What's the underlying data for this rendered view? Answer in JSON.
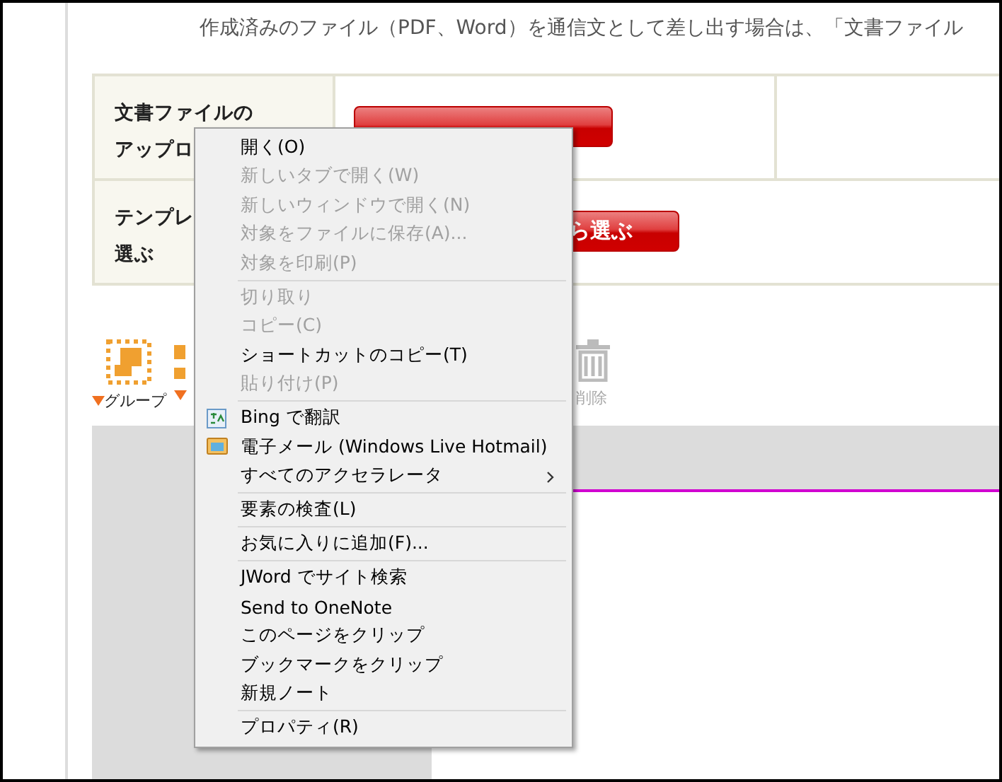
{
  "intro": "作成済みのファイル（PDF、Word）を通信文として差し出す場合は、「文書ファイル",
  "table": {
    "rows": [
      {
        "lines": [
          "文書ファイルの",
          "アップロ"
        ],
        "button": "",
        "extra_cell": true
      },
      {
        "lines": [
          "テンプレ",
          "選ぶ"
        ],
        "button": "ら選ぶ",
        "extra_cell": false
      }
    ]
  },
  "toolbar": [
    {
      "label": "グループ",
      "caret": true,
      "disabled": false
    },
    {
      "caret": true,
      "disabled": false
    },
    {
      "label": "削除",
      "caret": false,
      "disabled": true
    }
  ],
  "context_menu": {
    "groups": [
      [
        {
          "label": "開く(O)",
          "disabled": false
        },
        {
          "label": "新しいタブで開く(W)",
          "disabled": true
        },
        {
          "label": "新しいウィンドウで開く(N)",
          "disabled": true
        },
        {
          "label": "対象をファイルに保存(A)...",
          "disabled": true
        },
        {
          "label": "対象を印刷(P)",
          "disabled": true
        }
      ],
      [
        {
          "label": "切り取り",
          "disabled": true
        },
        {
          "label": "コピー(C)",
          "disabled": true
        },
        {
          "label": "ショートカットのコピー(T)",
          "disabled": false
        },
        {
          "label": "貼り付け(P)",
          "disabled": true
        }
      ],
      [
        {
          "label": "Bing で翻訳",
          "disabled": false,
          "kind": "translate"
        },
        {
          "label": "電子メール (Windows Live Hotmail)",
          "disabled": false,
          "kind": "mail"
        },
        {
          "label": "すべてのアクセラレータ",
          "disabled": false,
          "kind": "submenu"
        }
      ],
      [
        {
          "label": "要素の検査(L)",
          "disabled": false
        }
      ],
      [
        {
          "label": "お気に入りに追加(F)...",
          "disabled": false
        }
      ],
      [
        {
          "label": "JWord でサイト検索",
          "disabled": false
        },
        {
          "label": "Send to OneNote",
          "disabled": false
        },
        {
          "label": "このページをクリップ",
          "disabled": false
        },
        {
          "label": "ブックマークをクリップ",
          "disabled": false
        },
        {
          "label": "新規ノート",
          "disabled": false
        }
      ],
      [
        {
          "label": "プロパティ(R)",
          "disabled": false
        }
      ]
    ]
  }
}
